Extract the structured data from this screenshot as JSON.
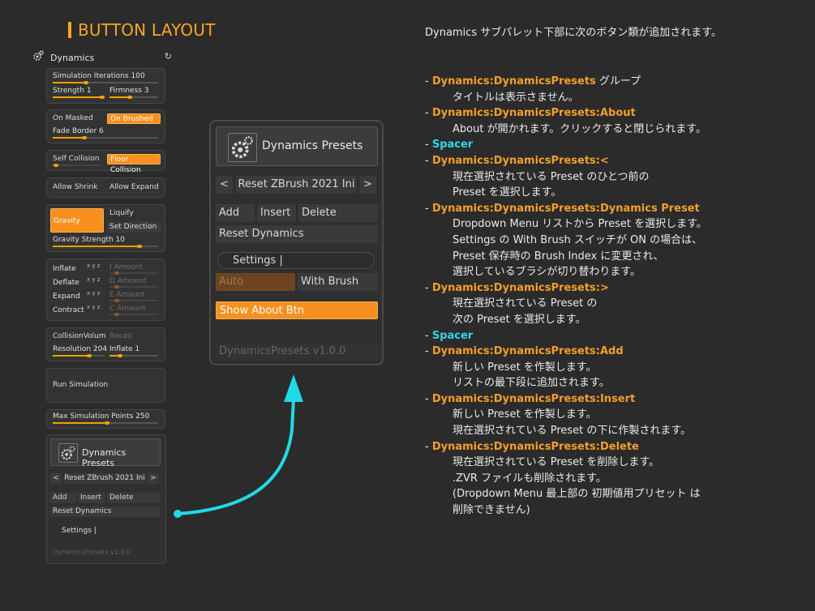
{
  "title": "BUTTON LAYOUT",
  "colors": {
    "accent": "#f7901e",
    "title": "#f6a623",
    "arrow": "#20d9e6",
    "spacer": "#32d6e8"
  },
  "dynamics": {
    "header": "Dynamics",
    "header_icon": "gear-icon",
    "reset_icon": "refresh-icon",
    "sim_iterations": "Simulation Iterations",
    "sim_iterations_val": "100",
    "strength": "Strength",
    "strength_val": "1",
    "firmness": "Firmness",
    "firmness_val": "3",
    "on_masked": "On Masked",
    "on_brushed": "On Brushed",
    "fade_border": "Fade Border",
    "fade_border_val": "6",
    "self_collision": "Self Collision",
    "floor_collision": "Floor Collision",
    "allow_shrink": "Allow Shrink",
    "allow_expand": "Allow Expand",
    "gravity": "Gravity",
    "liquify": "Liquify",
    "set_direction": "Set Direction",
    "gravity_strength": "Gravity Strength",
    "gravity_strength_val": "10",
    "inflate": "Inflate",
    "deflate": "Deflate",
    "expand": "Expand",
    "contract": "Contract",
    "mini_icon": "x y z",
    "i_amount": "I Amount",
    "d_amount": "D Amount",
    "e_amount": "E Amount",
    "c_amount": "C Amount",
    "collision_volume": "CollisionVolum",
    "recalc": "Recalc",
    "resolution": "Resolution",
    "resolution_val": "204",
    "inflate2": "Inflate",
    "inflate2_val": "1",
    "run_simulation": "Run Simulation",
    "max_sim_points": "Max Simulation Points",
    "max_sim_points_val": "250"
  },
  "presets_panel": {
    "presets_label": "Dynamics Presets",
    "prev": "<",
    "next": ">",
    "preset_name": "Reset ZBrush 2021 Ini",
    "add": "Add",
    "insert": "Insert",
    "delete": "Delete",
    "reset_dynamics": "Reset Dynamics",
    "settings": "Settings |",
    "auto": "Auto",
    "with_brush": "With Brush",
    "show_about": "Show About Btn",
    "version": "DynamicsPresets v1.0.0"
  },
  "intro": "Dynamics サブパレット下部に次のボタン類が追加されます。",
  "notes": [
    {
      "head": "Dynamics:DynamicsPresets",
      "type": "h",
      "tail": " グループ",
      "lines": [
        "タイトルは表示さません。"
      ]
    },
    {
      "head": "Dynamics:DynamicsPresets:About",
      "type": "h",
      "tail": "",
      "lines": [
        "About が開かれます。クリックすると閉じられます。"
      ]
    },
    {
      "head": "Spacer",
      "type": "s",
      "tail": "",
      "lines": []
    },
    {
      "head": "Dynamics:DynamicsPresets:<",
      "type": "h",
      "tail": "",
      "lines": [
        "現在選択されている Preset のひとつ前の",
        "Preset を選択します。"
      ]
    },
    {
      "head": "Dynamics:DynamicsPresets:Dynamics Preset",
      "type": "h",
      "tail": "",
      "lines": [
        "Dropdown Menu リストから Preset を選択します。",
        "Settings の With Brush スイッチが ON の場合は、",
        "Preset 保存時の Brush Index に変更され、",
        "選択しているブラシが切り替わります。"
      ]
    },
    {
      "head": "Dynamics:DynamicsPresets:>",
      "type": "h",
      "tail": "",
      "lines": [
        "現在選択されている Preset の",
        "次の Preset を選択します。"
      ]
    },
    {
      "head": "Spacer",
      "type": "s",
      "tail": "",
      "lines": []
    },
    {
      "head": "Dynamics:DynamicsPresets:Add",
      "type": "h",
      "tail": "",
      "lines": [
        "新しい Preset を作製します。",
        "リストの最下段に追加されます。"
      ]
    },
    {
      "head": "Dynamics:DynamicsPresets:Insert",
      "type": "h",
      "tail": "",
      "lines": [
        "新しい Preset を作製します。",
        "現在選択されている Preset の下に作製されます。"
      ]
    },
    {
      "head": "Dynamics:DynamicsPresets:Delete",
      "type": "h",
      "tail": "",
      "lines": [
        "現在選択されている Preset を削除します。",
        ".ZVR ファイルも削除されます。",
        "(Dropdown Menu 最上部の 初期値用プリセット は",
        " 削除できません)"
      ]
    }
  ]
}
